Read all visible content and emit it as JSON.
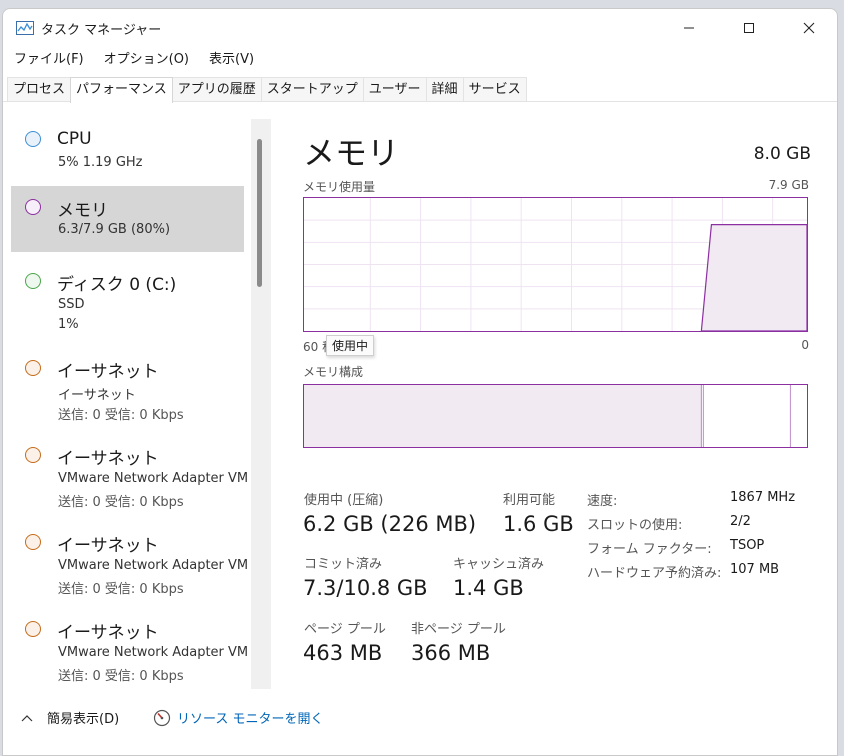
{
  "window": {
    "title": "タスク マネージャー",
    "controls": {
      "minimize": "minimize",
      "maximize": "maximize",
      "close": "close"
    }
  },
  "menu": [
    "ファイル(F)",
    "オプション(O)",
    "表示(V)"
  ],
  "tabs": [
    "プロセス",
    "パフォーマンス",
    "アプリの履歴",
    "スタートアップ",
    "ユーザー",
    "詳細",
    "サービス"
  ],
  "active_tab": "パフォーマンス",
  "sidebar": {
    "items": [
      {
        "title": "CPU",
        "line1": "5%  1.19 GHz",
        "line2": "",
        "color": "#3c8fd6"
      },
      {
        "title": "メモリ",
        "line1": "6.3/7.9 GB (80%)",
        "line2": "",
        "color": "#8b2fa1",
        "selected": true
      },
      {
        "title": "ディスク 0 (C:)",
        "line1": "SSD",
        "line2": "1%",
        "color": "#4aa64a"
      },
      {
        "title": "イーサネット",
        "line1": "イーサネット",
        "line2": "送信: 0  受信: 0 Kbps",
        "color": "#c76b1a"
      },
      {
        "title": "イーサネット",
        "line1": "VMware Network Adapter VM",
        "line2": "送信: 0  受信: 0 Kbps",
        "color": "#c76b1a"
      },
      {
        "title": "イーサネット",
        "line1": "VMware Network Adapter VM",
        "line2": "送信: 0  受信: 0 Kbps",
        "color": "#c76b1a"
      },
      {
        "title": "イーサネット",
        "line1": "VMware Network Adapter VM",
        "line2": "送信: 0  受信: 0 Kbps",
        "color": "#c76b1a"
      }
    ]
  },
  "main": {
    "title": "メモリ",
    "total": "8.0 GB",
    "usage_label": "メモリ使用量",
    "usage_max": "7.9 GB",
    "time_left": "60 秒",
    "time_right": "0",
    "tooltip": "使用中",
    "composition_label": "メモリ構成",
    "accent_color": "#8b2fa1",
    "usage_level": 0.8,
    "composition_in_use": 0.79
  },
  "stats": {
    "in_use_label": "使用中 (圧縮)",
    "in_use_value": "6.2 GB (226 MB)",
    "available_label": "利用可能",
    "available_value": "1.6 GB",
    "committed_label": "コミット済み",
    "committed_value": "7.3/10.8 GB",
    "cached_label": "キャッシュ済み",
    "cached_value": "1.4 GB",
    "paged_label": "ページ プール",
    "paged_value": "463 MB",
    "nonpaged_label": "非ページ プール",
    "nonpaged_value": "366 MB"
  },
  "specs": [
    {
      "label": "速度:",
      "value": "1867 MHz"
    },
    {
      "label": "スロットの使用:",
      "value": "2/2"
    },
    {
      "label": "フォーム ファクター:",
      "value": "TSOP"
    },
    {
      "label": "ハードウェア予約済み:",
      "value": "107 MB"
    }
  ],
  "footer": {
    "fewer_details": "簡易表示(D)",
    "resource_monitor": "リソース モニターを開く"
  }
}
